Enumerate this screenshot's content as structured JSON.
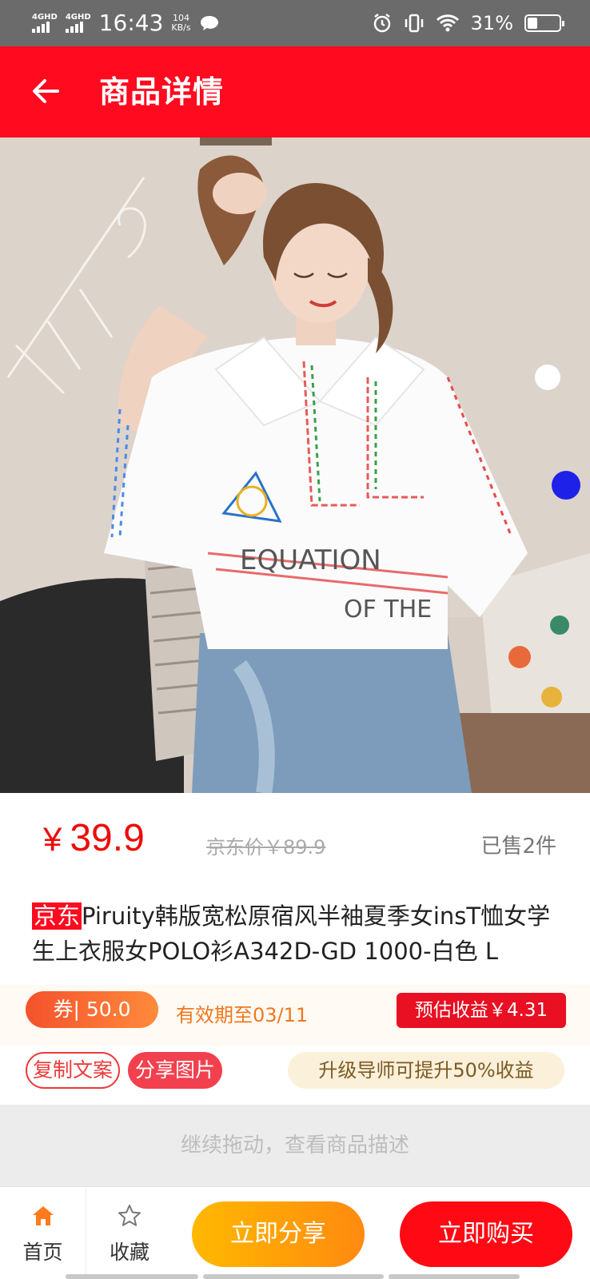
{
  "status_bar": {
    "network1": "4GHD",
    "network2": "4GHD",
    "time": "16:43",
    "speed_value": "104",
    "speed_unit": "KB/s",
    "battery_percent": "31%",
    "battery_level": 0.31,
    "icons": [
      "signal-icon",
      "chat-icon",
      "alarm-icon",
      "vibrate-icon",
      "wifi-icon",
      "battery-icon"
    ]
  },
  "header": {
    "title": "商品详情",
    "back_icon": "arrow-left-icon"
  },
  "carousel": {
    "image_alt": "product-photo",
    "total": 5,
    "active": 0
  },
  "product": {
    "currency": "¥",
    "price": "39.9",
    "original_price": "京东价￥89.9",
    "sold": "已售2件",
    "store_tag": "京东",
    "title": "Piruity韩版宽松原宿风半袖夏季女insT恤女学生上衣服女POLO衫A342D-GD 1000-白色 L"
  },
  "coupon": {
    "label": "券| 50.0",
    "valid_until": "有效期至03/11",
    "estimated_earnings": "预估收益￥4.31"
  },
  "actions": {
    "copy_text": "复制文案",
    "share_image": "分享图片",
    "upgrade_hint": "升级导师可提升50%收益"
  },
  "drag_hint": "继续拖动，查看商品描述",
  "bottom_bar": {
    "home_label": "首页",
    "favorite_label": "收藏",
    "share_label": "立即分享",
    "buy_label": "立即购买"
  },
  "colors": {
    "brand_red": "#ff0a1f",
    "price_red": "#ee0a0a",
    "share_orange": "#ffb800",
    "coupon_orange": "#f4522c"
  }
}
